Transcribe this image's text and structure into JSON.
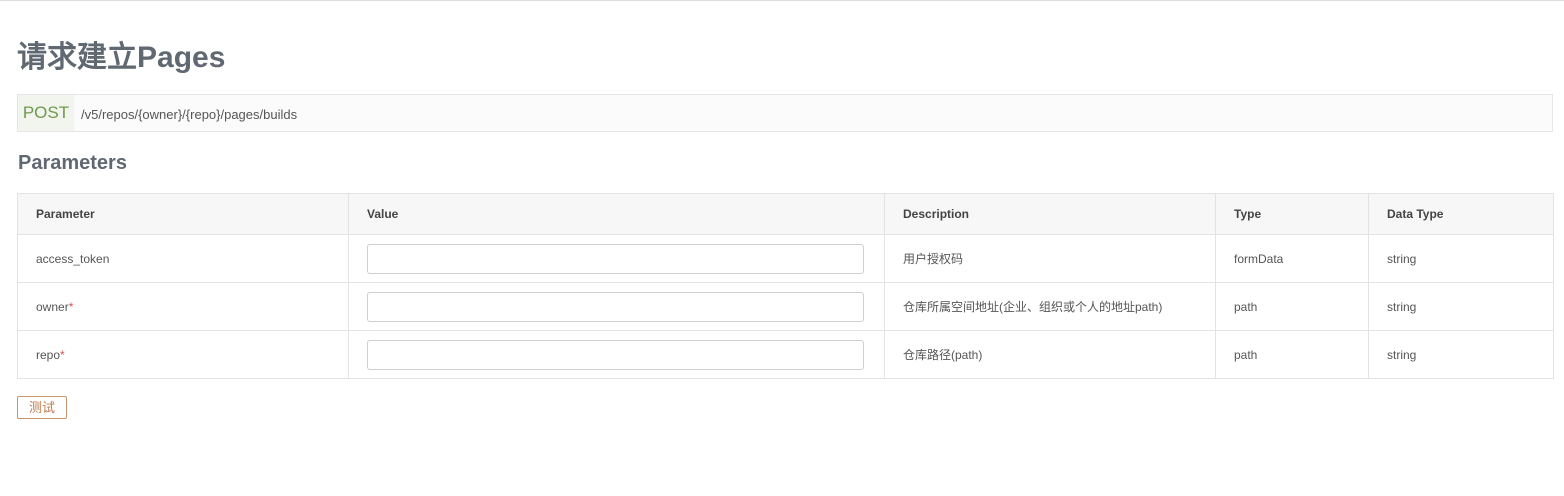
{
  "page_title": "请求建立Pages",
  "endpoint": {
    "method": "POST",
    "path": "/v5/repos/{owner}/{repo}/pages/builds",
    "method_color": "#6e9a4c"
  },
  "parameters": {
    "heading": "Parameters",
    "columns": {
      "parameter": "Parameter",
      "value": "Value",
      "description": "Description",
      "type": "Type",
      "data_type": "Data Type"
    },
    "rows": [
      {
        "name": "access_token",
        "required": "",
        "value": "",
        "description": "用户授权码",
        "type": "formData",
        "data_type": "string"
      },
      {
        "name": "owner",
        "required": "*",
        "value": "",
        "description": "仓库所属空间地址(企业、组织或个人的地址path)",
        "type": "path",
        "data_type": "string"
      },
      {
        "name": "repo",
        "required": "*",
        "value": "",
        "description": "仓库路径(path)",
        "type": "path",
        "data_type": "string"
      }
    ]
  },
  "actions": {
    "test_label": "测试"
  },
  "colors": {
    "title": "#606872",
    "required": "#d9534f",
    "test_button": "#c07a4e"
  }
}
